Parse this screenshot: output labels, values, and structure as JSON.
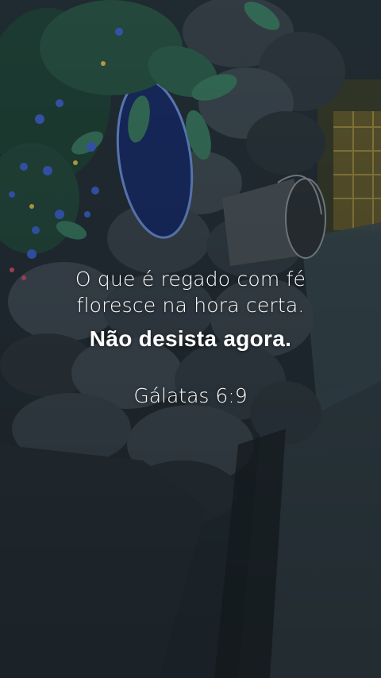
{
  "caption": {
    "line1": "O que é regado com fé",
    "line2": "floresce na hora certa.",
    "line3": "Não desista agora.",
    "reference": "Gálatas 6:9"
  },
  "scene": {
    "subjects": [
      "stone-wall",
      "flowering-plant",
      "blue-pot",
      "metal-bucket",
      "wooden-fence",
      "ground"
    ],
    "colors": {
      "background": "#1f2a2e",
      "stone": "#3e4a52",
      "stone_dark": "#27333a",
      "leaf": "#2f5a4a",
      "flower": "#3d63c9",
      "pot": "#1c3576",
      "bucket": "#50585e",
      "fence": "#8a7a3a",
      "ground": "#34434b"
    }
  }
}
